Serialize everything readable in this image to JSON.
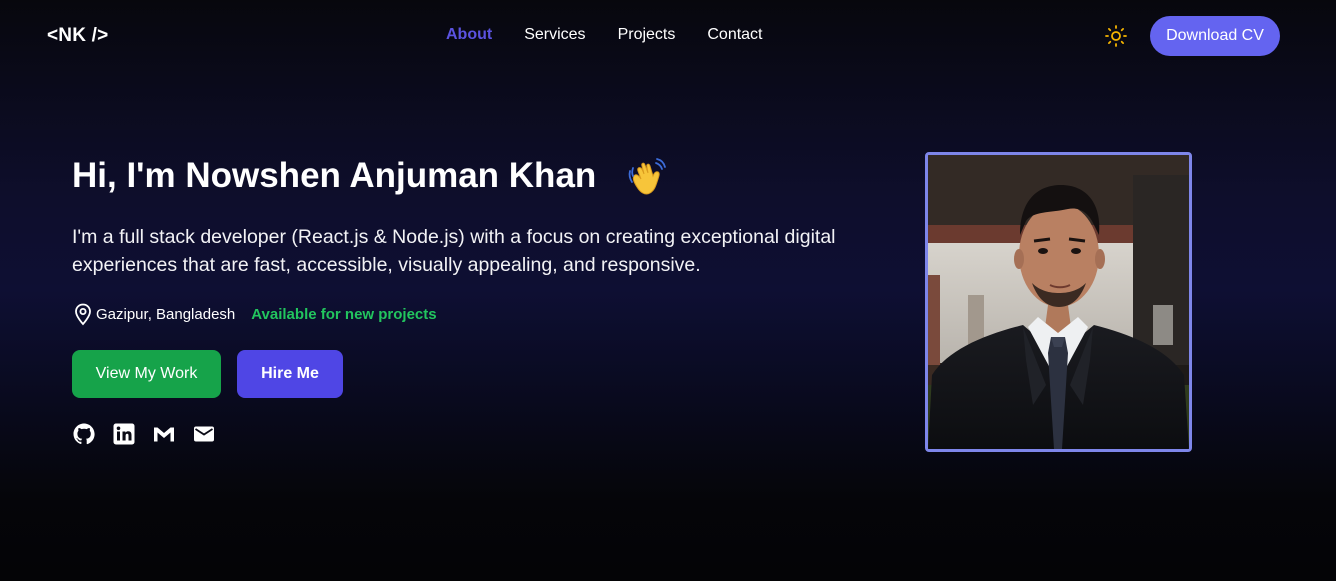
{
  "nav": {
    "logo": "<NK />",
    "links": [
      "About",
      "Services",
      "Projects",
      "Contact"
    ],
    "active_link": "About",
    "theme_icon": "sun-icon",
    "cv_button": "Download CV"
  },
  "hero": {
    "title": "Hi, I'm Nowshen Anjuman Khan",
    "title_emoji": "waving-hand-icon",
    "description": "I'm a full stack developer (React.js & Node.js) with a focus on creating exceptional digital experiences that are fast, accessible, visually appealing, and responsive.",
    "location": "Gazipur, Bangladesh",
    "availability": "Available for new projects",
    "primary_button": "View My Work",
    "secondary_button": "Hire Me",
    "socials": [
      "github-icon",
      "linkedin-icon",
      "gmail-icon",
      "email-icon"
    ]
  },
  "colors": {
    "accent": "#6464f0",
    "active_nav": "#5b53e0",
    "success": "#22c55e",
    "primary_button": "#16a34a",
    "secondary_button": "#4f46e5",
    "photo_border": "#7e86ea"
  }
}
